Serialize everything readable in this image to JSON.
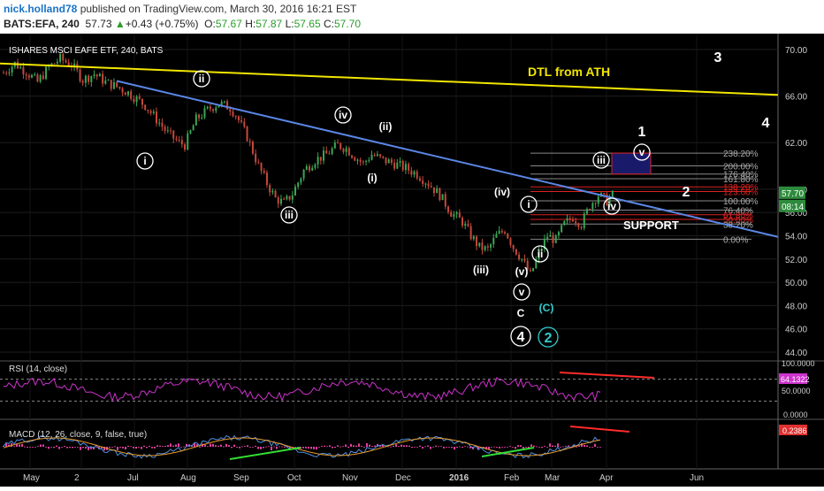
{
  "header": {
    "user": "nick.holland78",
    "published": " published on TradingView.com, March 30, 2016 16:21 EST",
    "symbol": "BATS:EFA, 240",
    "last": "57.73",
    "change": "+0.43 (+0.75%)",
    "o_label": "O:",
    "o_value": "57.67",
    "h_label": "H:",
    "h_value": "57.87",
    "l_label": "L:",
    "l_value": "57.65",
    "c_label": "C:",
    "c_value": "57.70"
  },
  "colors": {
    "background": "#000000",
    "up_candle": "#3aa655",
    "down_candle": "#c4493c",
    "dtl": "#f2e600",
    "trendline": "#5b86e5",
    "rsi": "#cc33cc",
    "macd": "#4f8fe0",
    "signal": "#e89b2c",
    "hist": "#e040a0",
    "divergence_red": "#ff2b2b",
    "divergence_green": "#33dd33",
    "fib_red": "#dd2222",
    "fib_box": "#1a1a6a"
  },
  "chart_data": {
    "type": "candlestick",
    "title": "ISHARES MSCI EAFE ETF, 240, BATS",
    "x_labels": [
      "May",
      "2",
      "Jul",
      "Aug",
      "Sep",
      "Oct",
      "Nov",
      "Dec",
      "2016",
      "Feb",
      "Mar",
      "Apr",
      "Jun"
    ],
    "y_ticks": [
      "70.00",
      "66.00",
      "62.00",
      "58.00",
      "56.00",
      "54.00",
      "52.00",
      "50.00",
      "48.00",
      "46.00",
      "44.00"
    ],
    "ylim": [
      44,
      71
    ],
    "price_label": "57.70",
    "countdown_label": "08:14",
    "price_path": [
      [
        0,
        68.0
      ],
      [
        4,
        68.8
      ],
      [
        8,
        68.1
      ],
      [
        12,
        67.2
      ],
      [
        16,
        68.5
      ],
      [
        20,
        69.2
      ],
      [
        24,
        68.7
      ],
      [
        28,
        67.4
      ],
      [
        32,
        67.9
      ],
      [
        36,
        67.2
      ],
      [
        40,
        66.8
      ],
      [
        44,
        66.3
      ],
      [
        50,
        65.2
      ],
      [
        54,
        64.0
      ],
      [
        58,
        62.8
      ],
      [
        62,
        62.0
      ],
      [
        64,
        61.8
      ],
      [
        68,
        64.0
      ],
      [
        72,
        64.8
      ],
      [
        76,
        65.4
      ],
      [
        80,
        65.0
      ],
      [
        82,
        64.4
      ],
      [
        86,
        62.5
      ],
      [
        90,
        60.0
      ],
      [
        93,
        58.5
      ],
      [
        96,
        57.2
      ],
      [
        99,
        56.8
      ],
      [
        102,
        57.6
      ],
      [
        106,
        59.6
      ],
      [
        110,
        60.5
      ],
      [
        114,
        61.0
      ],
      [
        118,
        61.8
      ],
      [
        121,
        61.5
      ],
      [
        124,
        60.8
      ],
      [
        127,
        60.2
      ],
      [
        130,
        61.0
      ],
      [
        134,
        60.5
      ],
      [
        138,
        60.2
      ],
      [
        142,
        59.8
      ],
      [
        146,
        59.3
      ],
      [
        150,
        58.5
      ],
      [
        154,
        57.5
      ],
      [
        158,
        56.0
      ],
      [
        162,
        55.2
      ],
      [
        165,
        54.0
      ],
      [
        168,
        53.0
      ],
      [
        171,
        52.8
      ],
      [
        174,
        54.0
      ],
      [
        177,
        54.5
      ],
      [
        180,
        53.0
      ],
      [
        183,
        52.0
      ],
      [
        186,
        50.6
      ],
      [
        189,
        52.5
      ],
      [
        192,
        54.0
      ],
      [
        195,
        53.6
      ],
      [
        198,
        55.0
      ],
      [
        201,
        55.6
      ],
      [
        204,
        55.0
      ],
      [
        207,
        56.6
      ],
      [
        210,
        57.5
      ],
      [
        213,
        57.0
      ],
      [
        216,
        57.7
      ]
    ],
    "dtl_label": "DTL from ATH",
    "support_label": "SUPPORT",
    "fib_levels": [
      {
        "label": "238.20%",
        "value": 61.1
      },
      {
        "label": "200.00%",
        "value": 60.0
      },
      {
        "label": "176.40%",
        "value": 59.3
      },
      {
        "label": "161.80%",
        "value": 58.9
      },
      {
        "label": "138.20%",
        "value": 58.2
      },
      {
        "label": "123.60%",
        "value": 57.8
      },
      {
        "label": "100.00%",
        "value": 57.0
      },
      {
        "label": "76.40%",
        "value": 56.2
      },
      {
        "label": "61.80%",
        "value": 55.8
      },
      {
        "label": "50.00%",
        "value": 55.4
      },
      {
        "label": "38.20%",
        "value": 55.0
      },
      {
        "label": "0.00%",
        "value": 53.7
      }
    ],
    "wave_labels": [
      "ⓘ",
      "ⓘⓘ",
      "ⓘⓘⓘ",
      "ⓘⓥ",
      "ⓥ"
    ],
    "wave_annotations": [
      {
        "text": "i",
        "circled": true
      },
      {
        "text": "ii",
        "circled": true
      },
      {
        "text": "iii",
        "circled": true
      },
      {
        "text": "iv",
        "circled": true
      },
      {
        "text": "(ii)",
        "circled": false
      },
      {
        "text": "(i)",
        "circled": false
      },
      {
        "text": "(iv)",
        "circled": false
      },
      {
        "text": "(iii)",
        "circled": false
      },
      {
        "text": "(v)",
        "circled": false
      },
      {
        "text": "v",
        "circled": true
      },
      {
        "text": "C",
        "circled": false
      },
      {
        "text": "(C)",
        "circled": false
      },
      {
        "text": "4",
        "circled": true
      },
      {
        "text": "2",
        "circled": true
      },
      {
        "text": "i",
        "circled": true
      },
      {
        "text": "ii",
        "circled": true
      },
      {
        "text": "iii",
        "circled": true
      },
      {
        "text": "iv",
        "circled": true
      },
      {
        "text": "v",
        "circled": true
      },
      {
        "text": "1",
        "circled": false
      },
      {
        "text": "2",
        "circled": false
      },
      {
        "text": "3",
        "circled": false
      },
      {
        "text": "4",
        "circled": false
      }
    ],
    "rsi": {
      "label": "RSI (14, close)",
      "value_label": "64.1322",
      "y_ticks": [
        "100.0000",
        "50.0000"
      ]
    },
    "macd": {
      "label": "MACD (12, 26, close, 9, false, true)",
      "value_label": "0.2386",
      "y_ticks": [
        "0.0000"
      ]
    }
  }
}
